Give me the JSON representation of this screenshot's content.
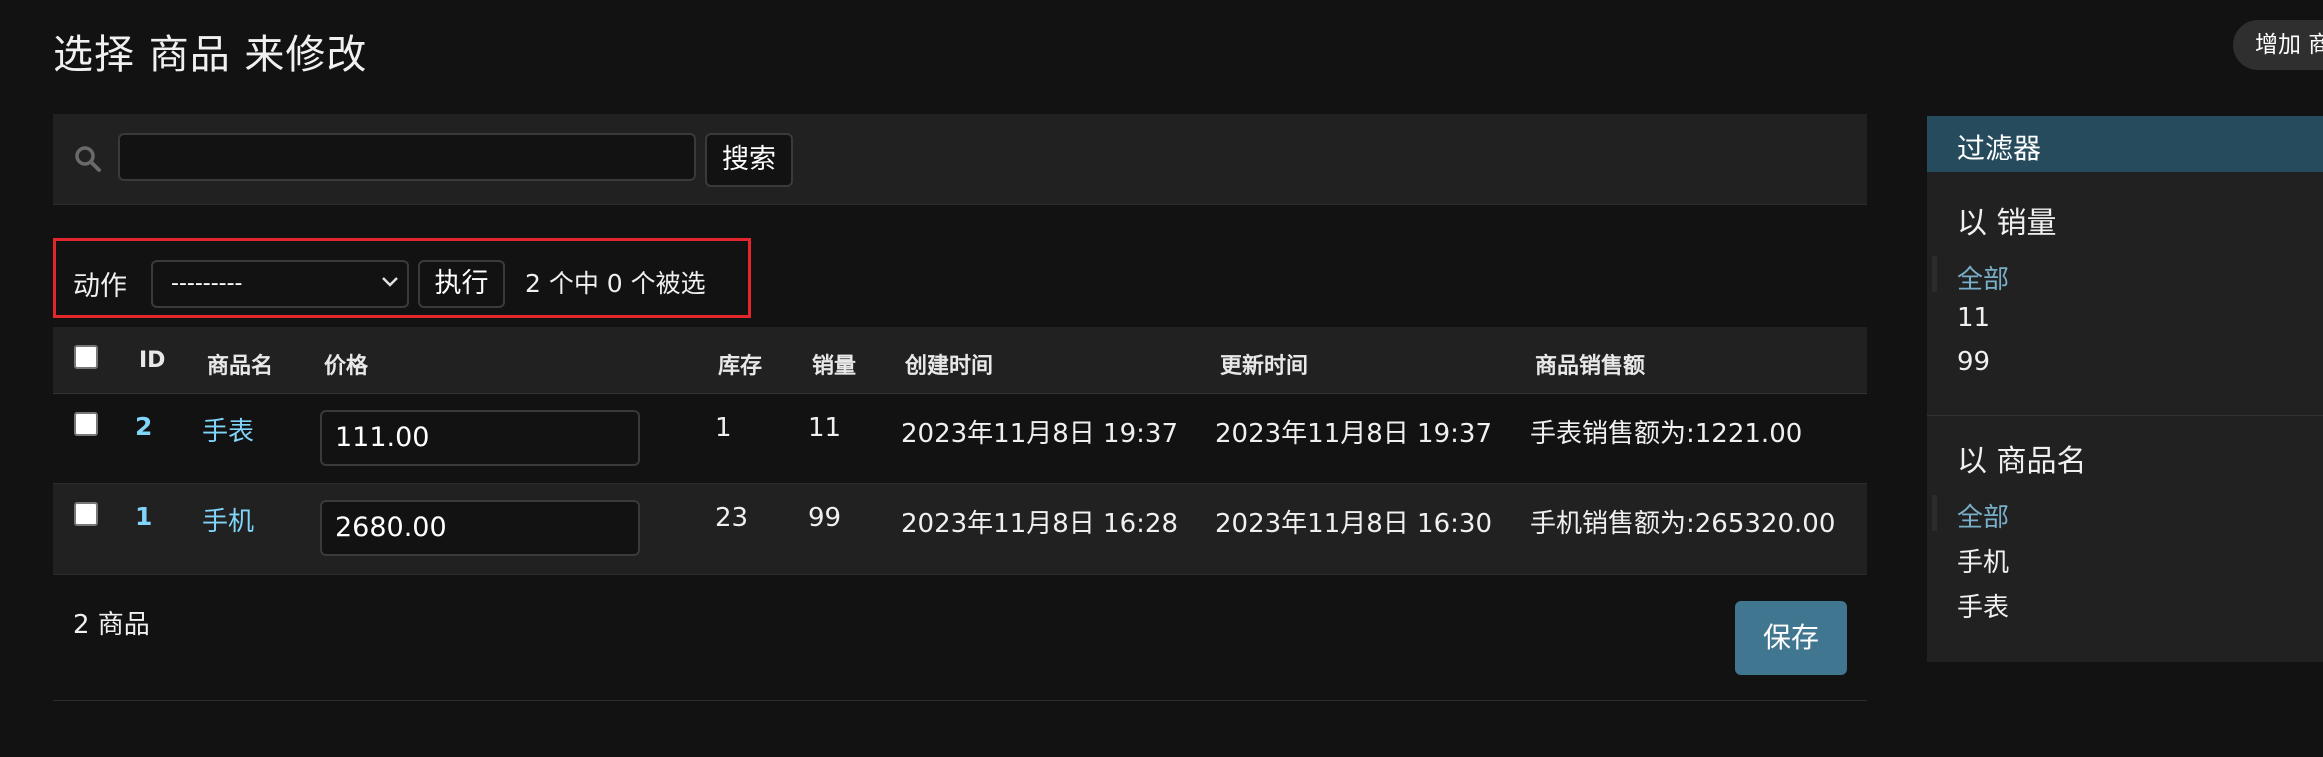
{
  "page": {
    "title": "选择 商品 来修改",
    "add_button": "增加 商品"
  },
  "search": {
    "value": "",
    "placeholder": "",
    "button": "搜索"
  },
  "actions": {
    "label": "动作",
    "selected_option": "---------",
    "go_button": "执行",
    "counter": "2 个中 0 个被选"
  },
  "table": {
    "headers": [
      "ID",
      "商品名",
      "价格",
      "库存",
      "销量",
      "创建时间",
      "更新时间",
      "商品销售额"
    ],
    "rows": [
      {
        "id": "2",
        "name": "手表",
        "price": "111.00",
        "stock": "1",
        "sales": "11",
        "created": "2023年11月8日 19:37",
        "updated": "2023年11月8日 19:37",
        "revenue": "手表销售额为:1221.00"
      },
      {
        "id": "1",
        "name": "手机",
        "price": "2680.00",
        "stock": "23",
        "sales": "99",
        "created": "2023年11月8日 16:28",
        "updated": "2023年11月8日 16:30",
        "revenue": "手机销售额为:265320.00"
      }
    ]
  },
  "footer": {
    "count": "2 商品",
    "save_button": "保存"
  },
  "filter": {
    "title": "过滤器",
    "groups": [
      {
        "heading": "以 销量",
        "items": [
          "全部",
          "11",
          "99"
        ],
        "selected": "全部"
      },
      {
        "heading": "以 商品名",
        "items": [
          "全部",
          "手机",
          "手表"
        ],
        "selected": "全部"
      }
    ]
  },
  "colors": {
    "background": "#121212",
    "panel": "#212121",
    "link": "#81d4fa",
    "filter_header": "#264b5d",
    "save_button": "#417690",
    "highlight_border": "#e3262c"
  }
}
